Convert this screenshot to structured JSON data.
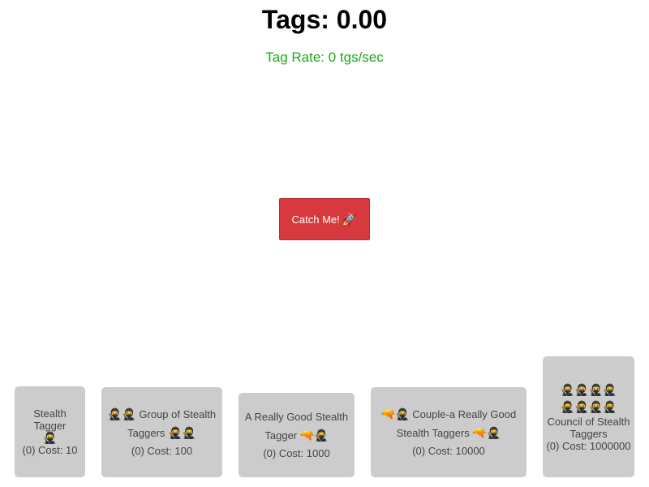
{
  "header": {
    "score_text": "Tags: 0.00",
    "rate_text": "Tag Rate: 0 tgs/sec"
  },
  "catch_button": {
    "label": "Catch Me!",
    "icon": "rocket-icon",
    "icon_glyph": "🚀"
  },
  "upgrades": [
    {
      "name_before": "Stealth Tagger",
      "emojis_before": "",
      "emojis_after": "🥷",
      "cost_text": "(0) Cost: 10"
    },
    {
      "name_before": "Group of Stealth Taggers",
      "emojis_before": "🥷🥷",
      "emojis_after": "🥷🥷",
      "cost_text": "(0) Cost: 100"
    },
    {
      "name_before": "A Really Good Stealth Tagger",
      "emojis_before": "",
      "emojis_after": "🔫🥷",
      "cost_text": "(0) Cost: 1000"
    },
    {
      "name_before": "Couple-a Really Good Stealth Taggers",
      "emojis_before": "🔫🥷",
      "emojis_after": "🔫🥷",
      "cost_text": "(0) Cost: 10000"
    },
    {
      "name_before": "Council of Stealth Taggers",
      "emojis_before": "🥷🥷🥷🥷🥷🥷🥷🥷",
      "emojis_after": "",
      "cost_text": "(0) Cost: 1000000"
    }
  ],
  "colors": {
    "rate": "#1aab1a",
    "button": "#d63a3e",
    "card": "#cccccc"
  }
}
